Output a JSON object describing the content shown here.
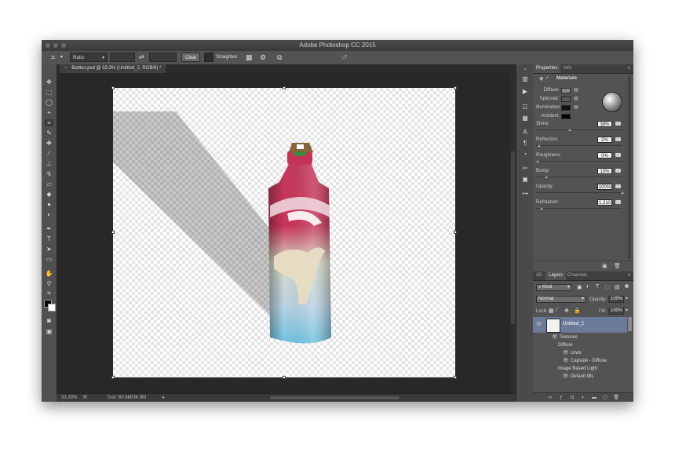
{
  "window": {
    "title": "Adobe Photoshop CC 2015"
  },
  "options_bar": {
    "crop_icon": "crop-icon",
    "ratio_select": "Ratio",
    "swap_icon": "swap-arrows-icon",
    "clear_button": "Clear",
    "straighten_label": "Straighten",
    "grid_icon": "grid-overlay-icon",
    "gear_icon": "gear-icon",
    "content_aware_icon": "content-aware-crop-icon",
    "reset_icon": "reset-rotate-icon"
  },
  "document_tab": {
    "label": "Bottles.psd @ 33.3% (Untitled_2, RGB/8) *"
  },
  "status_bar": {
    "zoom": "33.33%",
    "doc_size": "Doc: 60.6M/34.0M"
  },
  "properties": {
    "tabs": [
      "Properties",
      "Info"
    ],
    "section_title": "Materials",
    "material_rows": [
      {
        "label": "Diffuse:",
        "color": "#8c8c8c"
      },
      {
        "label": "Specular:",
        "color": "#5a5a5a"
      },
      {
        "label": "Illumination:",
        "color": "#111111"
      },
      {
        "label": "Ambient:",
        "color": "#050505"
      }
    ],
    "sliders": [
      {
        "label": "Shine:",
        "value": "38%",
        "level": 0.38
      },
      {
        "label": "Reflection:",
        "value": "2%",
        "level": 0.02
      },
      {
        "label": "Roughness:",
        "value": "0%",
        "level": 0.0
      },
      {
        "label": "Bump:",
        "value": "10%",
        "level": 0.1
      },
      {
        "label": "Opacity:",
        "value": "100%",
        "level": 1.0
      },
      {
        "label": "Refraction:",
        "value": "1.210",
        "level": 0.05
      }
    ]
  },
  "layers": {
    "tabs": [
      "3D",
      "Layers",
      "Channels"
    ],
    "kind_filter": "Kind",
    "blend_mode": "Normal",
    "opacity_label": "Opacity:",
    "opacity_value": "100%",
    "lock_label": "Lock:",
    "fill_label": "Fill:",
    "fill_value": "100%",
    "layer_name": "Untitled_2",
    "tree": [
      {
        "label": "Textures",
        "eye": true
      },
      {
        "label": "Diffuse",
        "eye": false
      },
      {
        "label": "cows",
        "eye": true
      },
      {
        "label": "Capsule - Diffuse",
        "eye": true
      },
      {
        "label": "Image Based Light",
        "eye": false
      },
      {
        "label": "Default IBL",
        "eye": true
      }
    ]
  },
  "colors": {
    "accent": "#6b7a99",
    "panel": "#535353",
    "workspace": "#282828"
  }
}
